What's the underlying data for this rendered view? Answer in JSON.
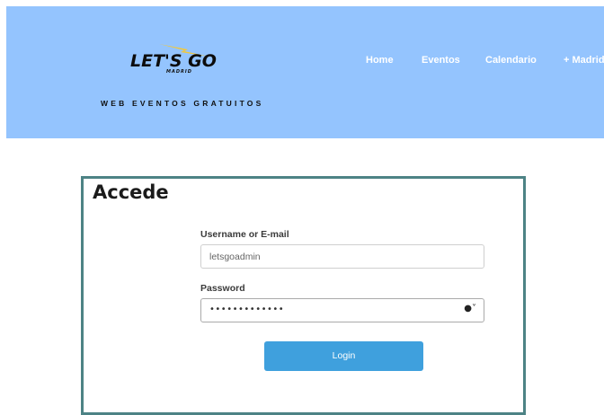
{
  "brand": {
    "logo_text": "LET'S GO",
    "logo_subtext": "MADRID",
    "tagline": "WEB EVENTOS GRATUITOS"
  },
  "nav": {
    "items": [
      {
        "label": "Home"
      },
      {
        "label": "Eventos"
      },
      {
        "label": "Calendario"
      },
      {
        "label": "+ Madrid"
      }
    ]
  },
  "login": {
    "title": "Accede",
    "username_label": "Username or E-mail",
    "username_value": "letsgoadmin",
    "password_label": "Password",
    "password_mask": "•••••••••••••",
    "submit_label": "Login"
  },
  "colors": {
    "header_bg": "#94c4fe",
    "card_border": "#4d8385",
    "button_bg": "#3fa0dd",
    "logo_bolt": "#f2c83a"
  }
}
